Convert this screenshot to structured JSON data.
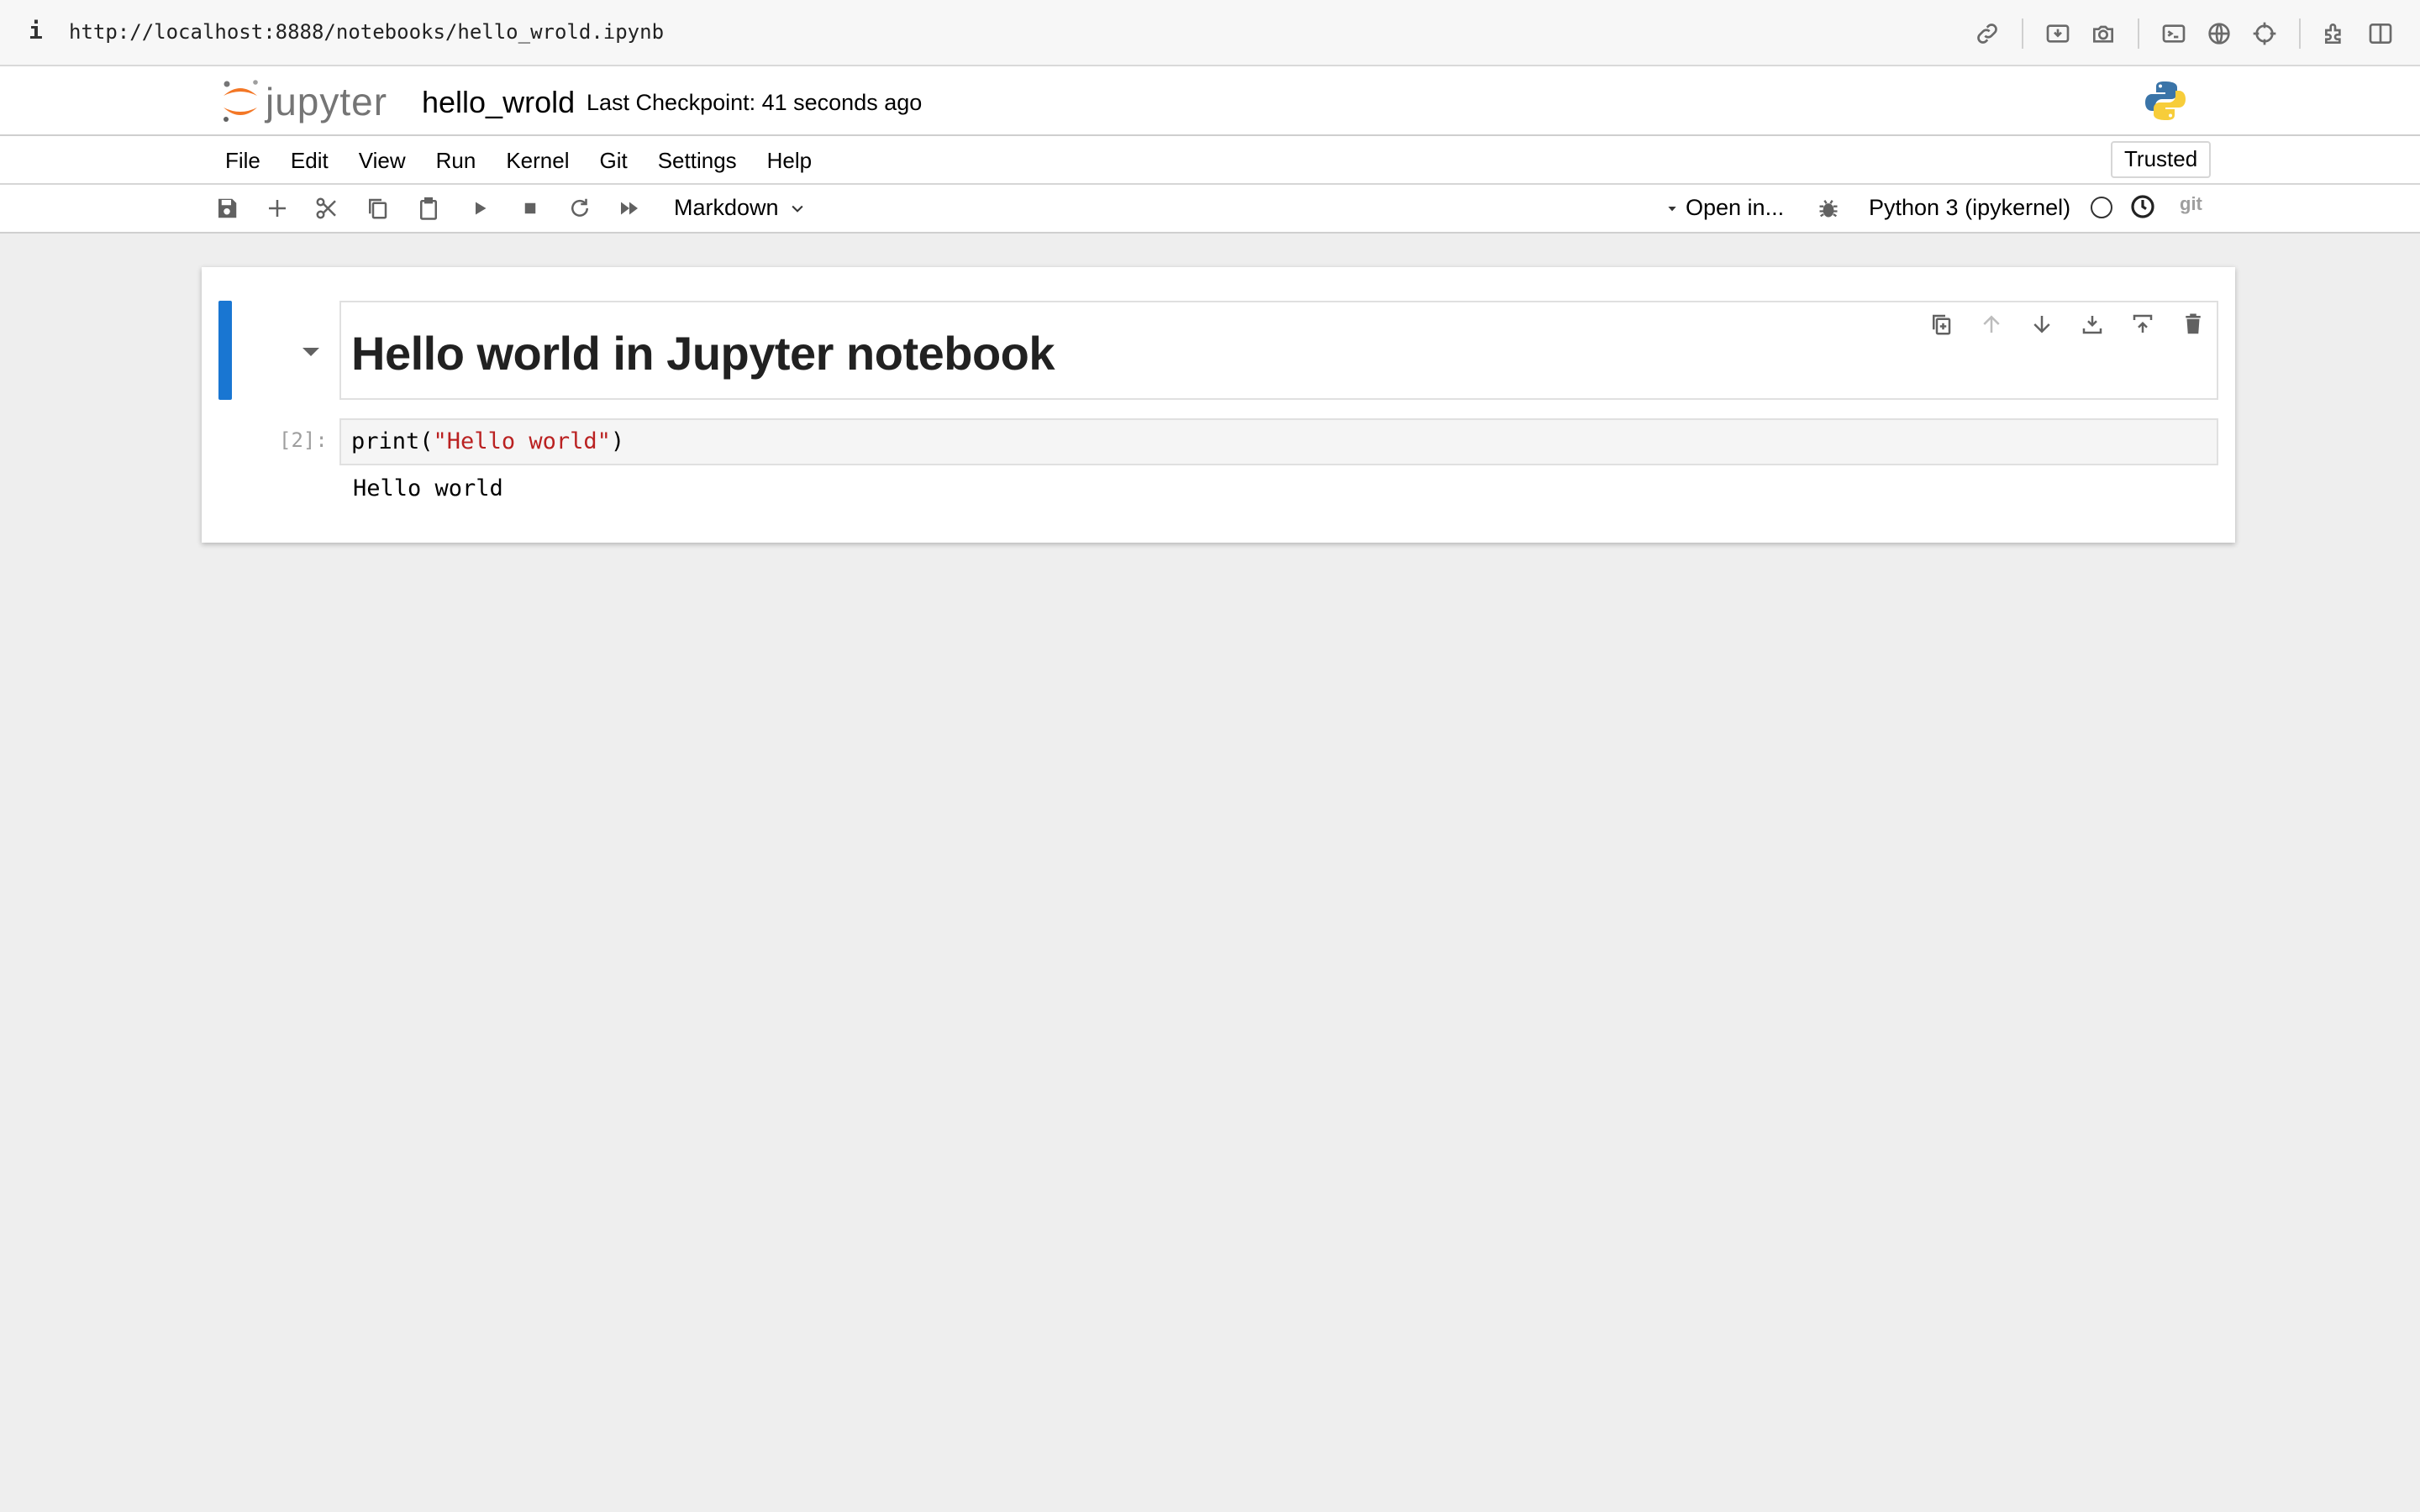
{
  "browser": {
    "info_glyph": "i",
    "url": "http://localhost:8888/notebooks/hello_wrold.ipynb",
    "icons": [
      "link-icon",
      "import-icon",
      "camera-icon",
      "terminal-icon",
      "globe-icon",
      "crosshair-icon",
      "extensions-icon",
      "split-view-icon"
    ]
  },
  "header": {
    "logo_text": "jupyter",
    "notebook_title": "hello_wrold",
    "checkpoint": "Last Checkpoint: 41 seconds ago",
    "kernel_logo": "python-logo-icon"
  },
  "menu": {
    "items": [
      "File",
      "Edit",
      "View",
      "Run",
      "Kernel",
      "Git",
      "Settings",
      "Help"
    ],
    "trusted_label": "Trusted"
  },
  "toolbar": {
    "buttons": [
      "save-icon",
      "add-cell-icon",
      "cut-icon",
      "copy-icon",
      "paste-icon",
      "run-icon",
      "stop-icon",
      "restart-icon",
      "fast-forward-icon"
    ],
    "cell_type": "Markdown",
    "open_in": "Open in...",
    "kernel_name": "Python 3 (ipykernel)",
    "git_label": "git"
  },
  "cells": {
    "markdown": {
      "heading": "Hello world in Jupyter notebook",
      "tools": [
        "duplicate-cell-icon",
        "move-up-icon",
        "move-down-icon",
        "insert-above-icon",
        "insert-below-icon",
        "delete-cell-icon"
      ]
    },
    "code": {
      "prompt": "[2]:",
      "code_prefix": "print(",
      "code_string": "\"Hello world\"",
      "code_suffix": ")",
      "output": "Hello world"
    }
  },
  "colors": {
    "accent": "#1976d2",
    "logo_orange": "#f37726",
    "string": "#ba2121",
    "background": "#eeeeee"
  }
}
